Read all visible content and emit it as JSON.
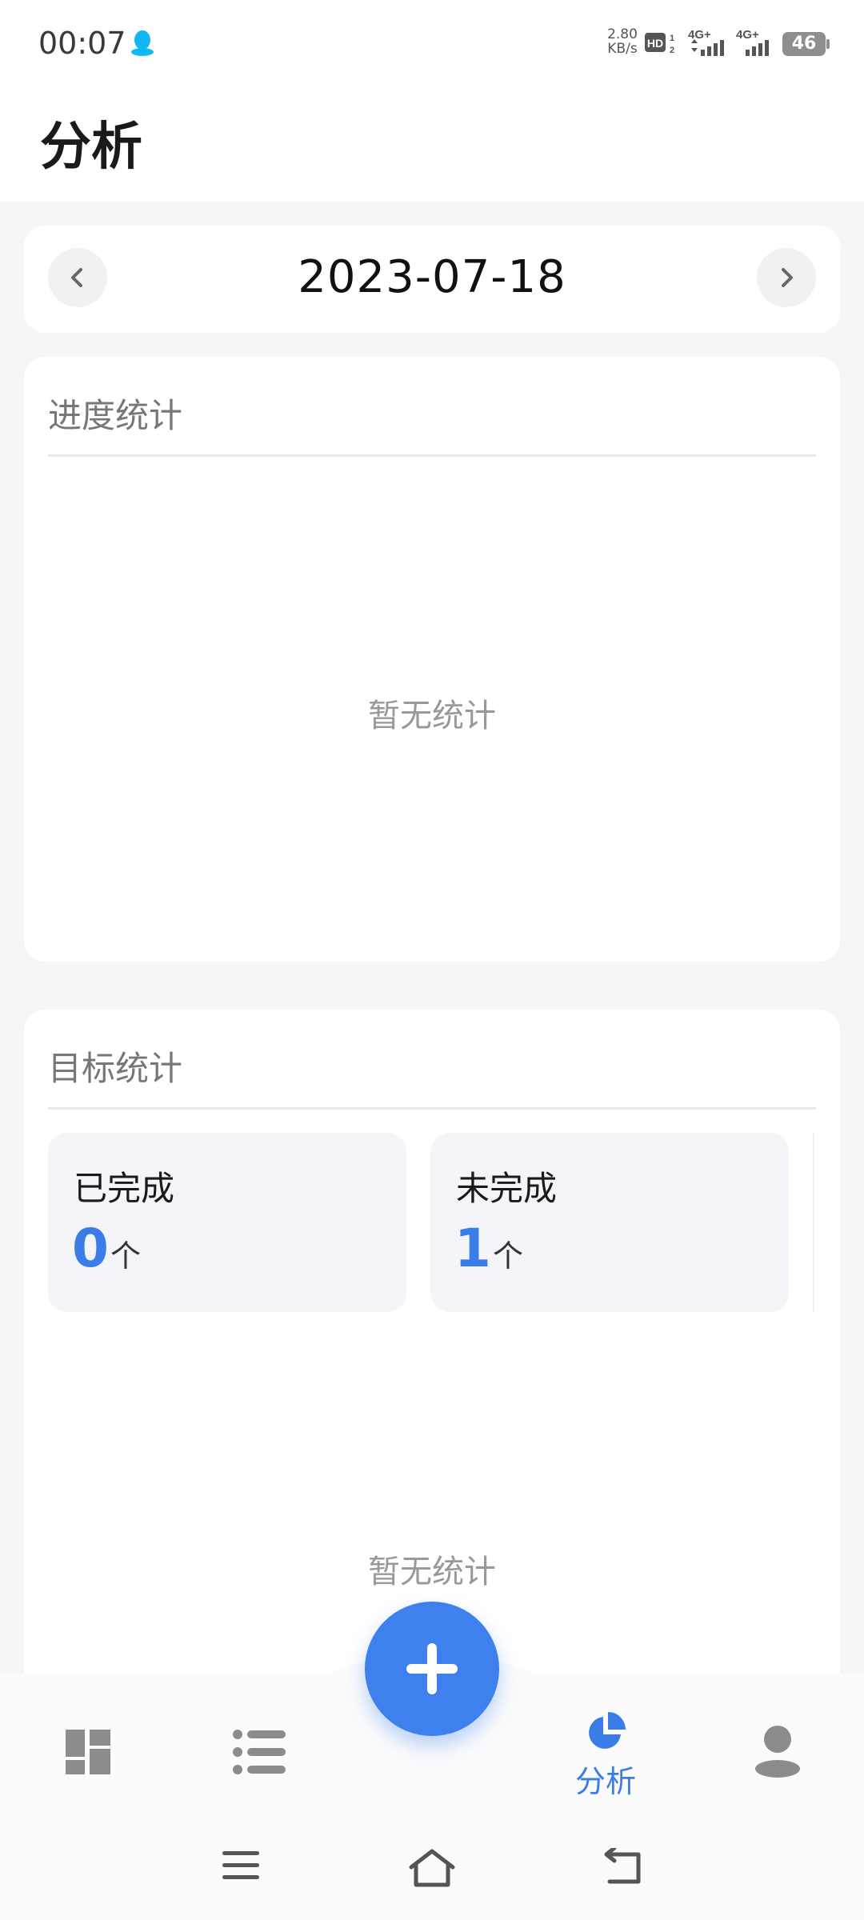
{
  "status_bar": {
    "time": "00:07",
    "net_speed_value": "2.80",
    "net_speed_unit": "KB/s",
    "hd_label": "HD",
    "hd_sim1": "1",
    "hd_sim2": "2",
    "signal1_label": "4G+",
    "signal2_label": "4G+",
    "battery": "46",
    "qq_color": "#12b7f5"
  },
  "header": {
    "title": "分析"
  },
  "date_nav": {
    "date": "2023-07-18"
  },
  "progress_stats": {
    "title": "进度统计",
    "empty_text": "暂无统计"
  },
  "goal_stats": {
    "title": "目标统计",
    "tiles": [
      {
        "label": "已完成",
        "value": "0",
        "unit": "个"
      },
      {
        "label": "未完成",
        "value": "1",
        "unit": "个"
      }
    ],
    "empty_text": "暂无统计"
  },
  "bottom_nav": {
    "items": [
      {
        "icon": "dashboard-icon"
      },
      {
        "icon": "list-icon"
      },
      {
        "icon": "pie-chart-icon",
        "label": "分析",
        "active": true
      },
      {
        "icon": "profile-icon"
      }
    ],
    "fab_icon": "plus-icon"
  },
  "colors": {
    "accent": "#3b7de8",
    "fab": "#3d80ee",
    "background": "#f5f6f8",
    "inactive_icon": "#8c8c8c"
  }
}
